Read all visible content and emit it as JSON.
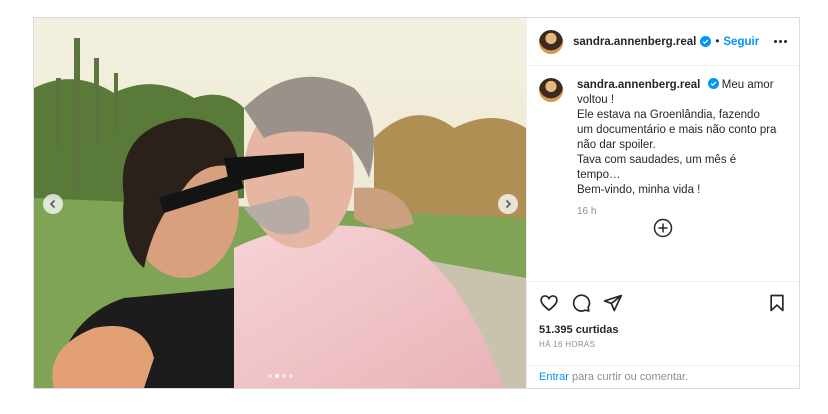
{
  "post": {
    "username": "sandra.annenberg.real",
    "follow_label": "Seguir",
    "separator": "•",
    "caption_lines": [
      "Meu amor voltou !",
      "Ele estava na Groenlândia, fazendo um documentário e mais não conto pra não dar spoiler.",
      "Tava com saudades, um mês é tempo…",
      "Bem-vindo, minha vida !"
    ],
    "caption_first": "Meu amor voltou !",
    "caption_rest": "Ele estava na Groenlândia, fazendo um documentário e mais não conto pra não dar spoiler.\nTava com saudades, um mês é tempo…\nBem-vindo, minha vida !",
    "comment_age": "16 h",
    "likes": "51.395 curtidas",
    "posted_ago": "HÁ 16 HORAS",
    "login_link": "Entrar",
    "login_suffix": "para curtir ou comentar.",
    "carousel": {
      "slide_count": 4,
      "active_index": 1
    },
    "icons": {
      "verified": "verified-badge-icon",
      "more": "more-options-icon",
      "add": "add-circle-icon",
      "like": "heart-icon",
      "comment": "comment-icon",
      "share": "share-icon",
      "save": "bookmark-icon",
      "prev": "chevron-left-icon",
      "next": "chevron-right-icon"
    },
    "colors": {
      "link_blue": "#0095f6",
      "verified_blue": "#0095f6",
      "text": "#262626",
      "muted": "#8e8e8e"
    }
  }
}
